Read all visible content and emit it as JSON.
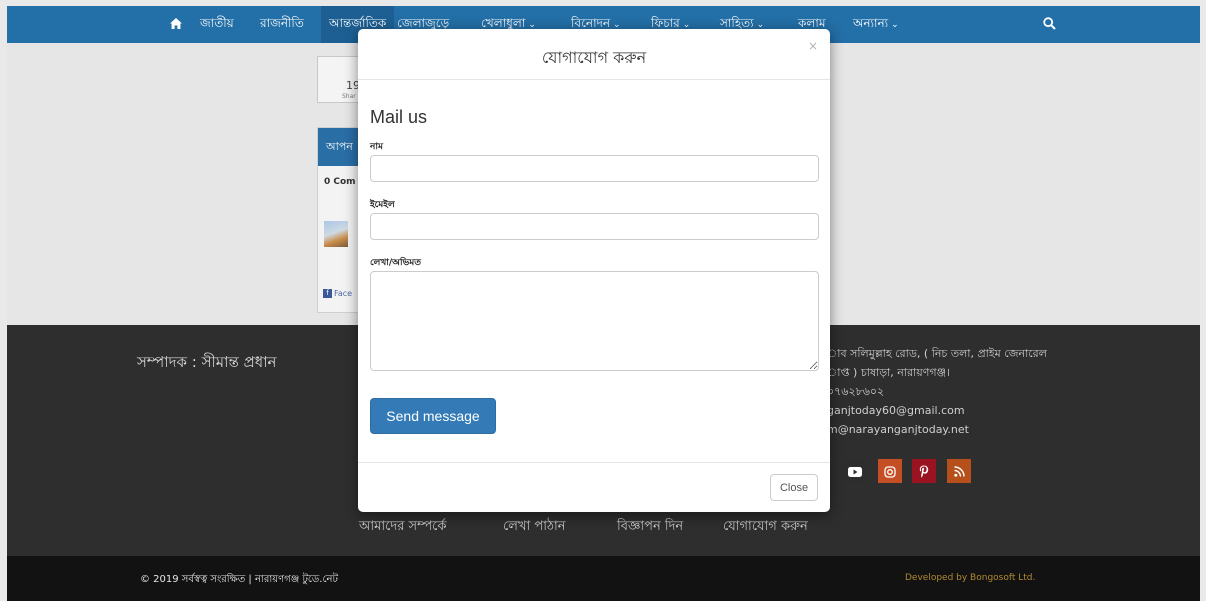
{
  "nav": {
    "items": [
      {
        "label": "জাতীয়",
        "dropdown": false
      },
      {
        "label": "রাজনীতি",
        "dropdown": false
      },
      {
        "label": "আন্তর্জাতিক",
        "dropdown": false,
        "active": true
      },
      {
        "label": "জেলাজুড়ে",
        "dropdown": false
      },
      {
        "label": "খেলাধুলা",
        "dropdown": true
      },
      {
        "label": "বিনোদন",
        "dropdown": true
      },
      {
        "label": "ফিচার",
        "dropdown": true
      },
      {
        "label": "সাহিত্য",
        "dropdown": true
      },
      {
        "label": "কলাম",
        "dropdown": false
      },
      {
        "label": "অন্যান্য",
        "dropdown": true
      }
    ],
    "chevron": "⌄",
    "home_icon": "home-icon",
    "search_icon": "search-icon"
  },
  "share": {
    "count": "19",
    "label": "Shar"
  },
  "comments": {
    "header": "আপন",
    "count": "0 Com",
    "facebook_text": "Face"
  },
  "footer": {
    "editor": "সম্পাদক : সীমান্ত প্রধান",
    "address_lines": [
      "াব সলিমুল্লাহ রোড, ( নিচ তলা, প্রাইম জেনারেল",
      "াপ্ত ) চাষাড়া, নারায়ণগঞ্জ।",
      "০৭৬২৮৬০২",
      "ganjtoday60@gmail.com",
      "m@narayanganjtoday.net"
    ],
    "social": [
      {
        "icon": "youtube-icon",
        "glyph": "▶",
        "color": "#c4302b"
      },
      {
        "icon": "instagram-icon",
        "glyph": "◎",
        "color": "#d9622b"
      },
      {
        "icon": "pinterest-icon",
        "glyph": "P",
        "color": "#bd081c"
      },
      {
        "icon": "rss-icon",
        "glyph": "⁾",
        "color": "#f26522"
      }
    ],
    "links": [
      "আমাদের সম্পর্কে",
      "লেখা পাঠান",
      "বিজ্ঞাপন দিন",
      "যোগাযোগ করুন"
    ],
    "copyright": "© 2019 সর্বস্বত্ব সংরক্ষিত | নারায়ণগঞ্জ টুডে.নেট",
    "developer": "Developed by Bongosoft Ltd."
  },
  "modal": {
    "title": "যোগাযোগ করুন",
    "close_symbol": "×",
    "heading": "Mail us",
    "fields": {
      "name_label": "নাম",
      "name_value": "",
      "email_label": "ইমেইল",
      "email_value": "",
      "message_label": "লেখা/অভিমত",
      "message_value": ""
    },
    "send_label": "Send message",
    "close_label": "Close"
  },
  "colors": {
    "nav_bg": "#236fa7",
    "primary_button": "#337ab7",
    "overlay_dark": "#2e2e2e"
  }
}
